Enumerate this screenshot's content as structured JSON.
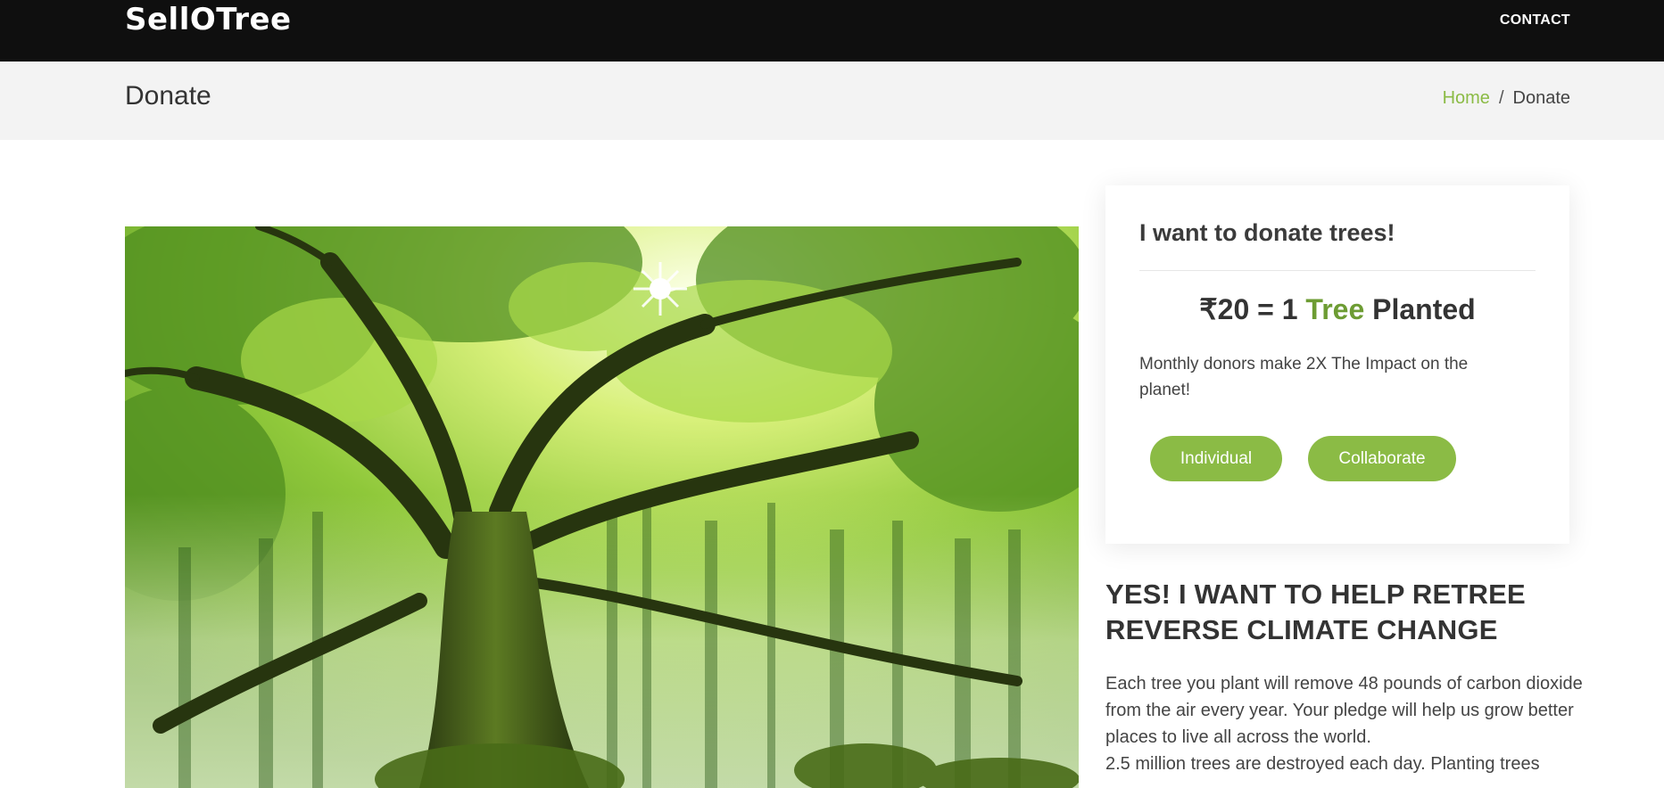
{
  "header": {
    "brand": "SellOTree",
    "nav": {
      "contact": "CONTACT"
    }
  },
  "page": {
    "title": "Donate",
    "breadcrumb": {
      "home": "Home",
      "separator": "/",
      "current": "Donate"
    }
  },
  "hero": {
    "image": "giant-tree-forest-image"
  },
  "donate_card": {
    "title": "I want to donate trees!",
    "rate_prefix": "₹20 = 1 ",
    "rate_highlight": "Tree",
    "rate_suffix": " Planted",
    "note": "Monthly donors make 2X The Impact on the planet!",
    "buttons": {
      "individual": "Individual",
      "collaborate": "Collaborate"
    }
  },
  "help": {
    "title": "YES! I WANT TO HELP RETREE REVERSE CLIMATE CHANGE",
    "paragraph1": "Each tree you plant will remove 48 pounds of carbon dioxide from the air every year. Your pledge will help us grow better places to live all across the world.",
    "paragraph2": "2.5 million trees are destroyed each day. Planting trees"
  },
  "colors": {
    "accent": "#8bbb45",
    "accent_dark": "#6d9c33",
    "topbar": "#0f0f0f",
    "pagebar": "#f3f3f3"
  }
}
